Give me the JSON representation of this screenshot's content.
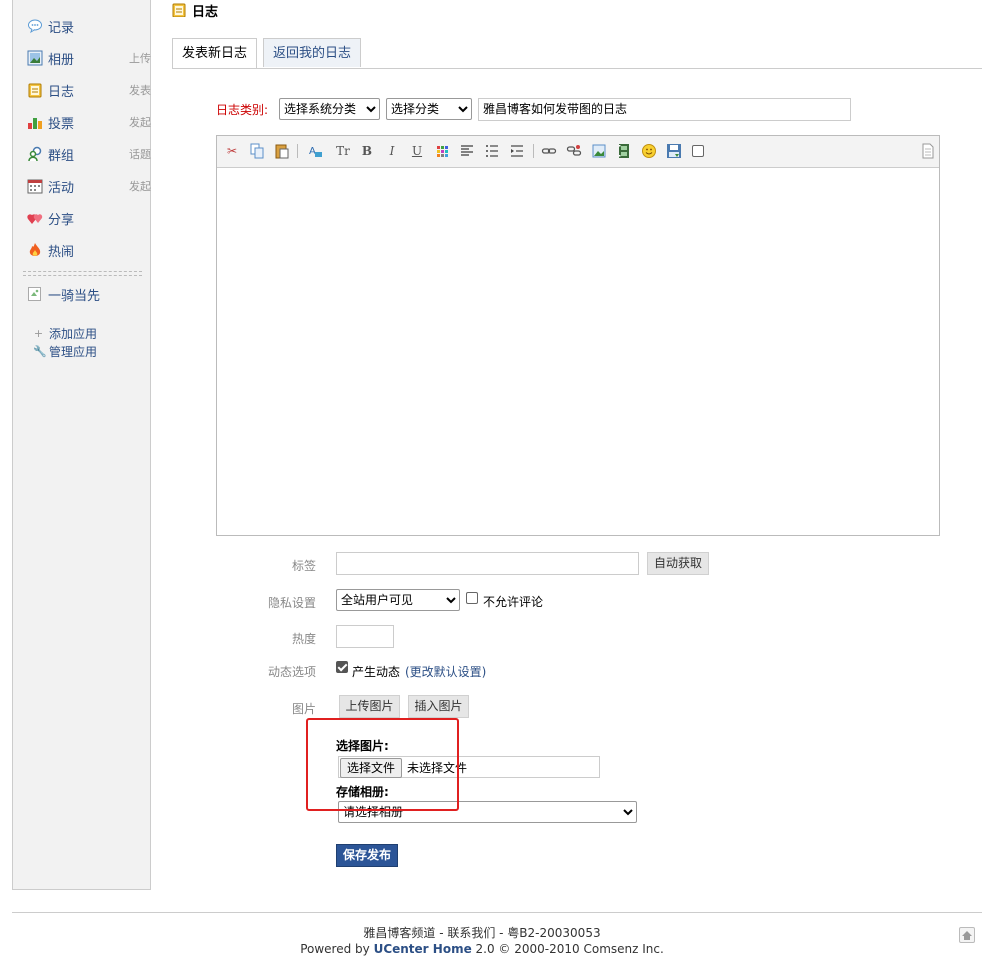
{
  "sidebar": {
    "items": [
      {
        "label": "记录",
        "action": ""
      },
      {
        "label": "相册",
        "action": "上传"
      },
      {
        "label": "日志",
        "action": "发表"
      },
      {
        "label": "投票",
        "action": "发起"
      },
      {
        "label": "群组",
        "action": "话题"
      },
      {
        "label": "活动",
        "action": "发起"
      },
      {
        "label": "分享",
        "action": ""
      },
      {
        "label": "热闹",
        "action": ""
      }
    ],
    "app_name": "一骑当先",
    "add_app": "添加应用",
    "manage_app": "管理应用"
  },
  "header": {
    "title": "日志"
  },
  "tabs": [
    {
      "label": "发表新日志"
    },
    {
      "label": "返回我的日志"
    }
  ],
  "form": {
    "category_label": "日志类别:",
    "system_category": "选择系统分类",
    "category": "选择分类",
    "title_value": "雅昌博客如何发带图的日志",
    "tag_label": "标签",
    "auto_fetch": "自动获取",
    "privacy_label": "隐私设置",
    "privacy_value": "全站用户可见",
    "no_comment": "不允许评论",
    "heat_label": "热度",
    "feed_label": "动态选项",
    "feed_text": "产生动态",
    "feed_link": "(更改默认设置)",
    "image_label": "图片",
    "upload_image": "上传图片",
    "insert_image": "插入图片",
    "choose_image": "选择图片:",
    "choose_file": "选择文件",
    "no_file": "未选择文件",
    "album_label": "存储相册:",
    "album_value": "请选择相册",
    "save": "保存发布"
  },
  "footer": {
    "line1": "雅昌博客频道 - 联系我们 - 粤B2-20030053",
    "powered_prefix": "Powered by ",
    "powered_brand": "UCenter Home",
    "powered_suffix": " 2.0 © 2000-2010 Comsenz Inc."
  },
  "colors": {
    "link": "#2c4f85",
    "accent": "#2c5597",
    "highlight": "#e02020"
  }
}
